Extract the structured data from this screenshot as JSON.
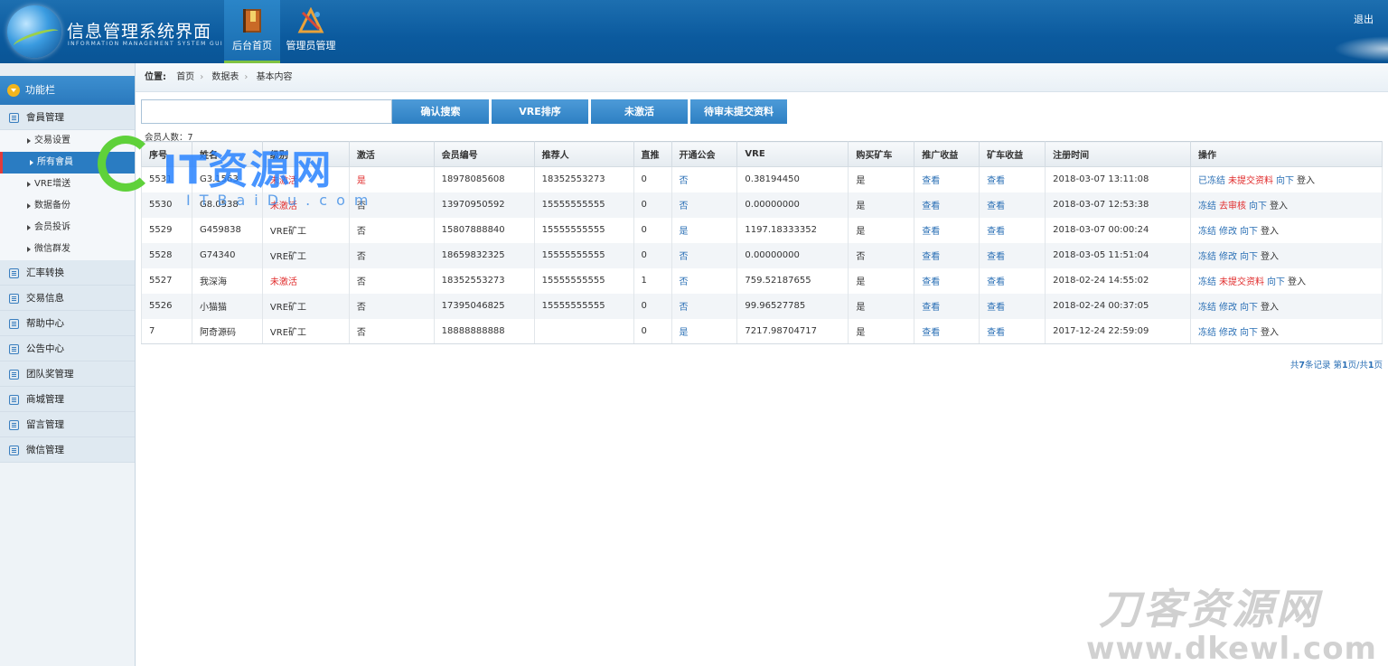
{
  "header": {
    "title": "信息管理系统界面",
    "subtitle": "INFORMATION MANAGEMENT SYSTEM GUI",
    "nav": [
      {
        "label": "后台首页",
        "icon": "book-icon"
      },
      {
        "label": "管理员管理",
        "icon": "tools-icon"
      }
    ],
    "logout": "退出"
  },
  "sidebar": {
    "title": "功能栏",
    "groups": [
      {
        "label": "會員管理",
        "icon": "list-icon"
      },
      {
        "label": "汇率转换",
        "icon": "chat-icon"
      },
      {
        "label": "交易信息",
        "icon": "list-icon"
      },
      {
        "label": "帮助中心",
        "icon": "edit-icon"
      },
      {
        "label": "公告中心",
        "icon": "edit-icon"
      },
      {
        "label": "团队奖管理",
        "icon": "calendar-icon"
      },
      {
        "label": "商城管理",
        "icon": "calendar-icon"
      },
      {
        "label": "留言管理",
        "icon": "edit-icon"
      },
      {
        "label": "微信管理",
        "icon": "chat-icon"
      }
    ],
    "subitems": [
      "交易设置",
      "所有會員",
      "VRE增送",
      "数据备份",
      "会员投诉",
      "微信群发"
    ]
  },
  "breadcrumb": {
    "label": "位置:",
    "items": [
      "首页",
      "数据表",
      "基本内容"
    ]
  },
  "search": {
    "placeholder": "",
    "buttons": [
      "确认搜索",
      "VRE排序",
      "未激活",
      "待审未提交资料"
    ]
  },
  "count_label": "会员人数：7",
  "table": {
    "headers": [
      "序号",
      "姓名",
      "级别",
      "激活",
      "会员编号",
      "推荐人",
      "直推",
      "开通公会",
      "VRE",
      "购买矿车",
      "推广收益",
      "矿车收益",
      "注册时间",
      "操作"
    ],
    "rows": [
      {
        "id": "5531",
        "name": "G3.1563",
        "level": "未激活",
        "active": "是",
        "no": "18978085608",
        "ref": "18352553273",
        "direct": "0",
        "guild": "否",
        "vre": "0.38194450",
        "buy": "是",
        "promo": "查看",
        "cart": "查看",
        "time": "2018-03-07 13:11:08",
        "ops": [
          {
            "t": "已冻结",
            "c": "link"
          },
          {
            "t": "未提交资料",
            "c": "red"
          },
          {
            "t": "向下",
            "c": "link"
          },
          {
            "t": "登入",
            "c": "plain"
          }
        ]
      },
      {
        "id": "5530",
        "name": "G8.0538",
        "level": "未激活",
        "active": "否",
        "no": "13970950592",
        "ref": "15555555555",
        "direct": "0",
        "guild": "否",
        "vre": "0.00000000",
        "buy": "是",
        "promo": "查看",
        "cart": "查看",
        "time": "2018-03-07 12:53:38",
        "ops": [
          {
            "t": "冻结",
            "c": "link"
          },
          {
            "t": "去审核",
            "c": "red"
          },
          {
            "t": "向下",
            "c": "link"
          },
          {
            "t": "登入",
            "c": "plain"
          }
        ]
      },
      {
        "id": "5529",
        "name": "G459838",
        "level": "VRE矿工",
        "active": "否",
        "no": "15807888840",
        "ref": "15555555555",
        "direct": "0",
        "guild": "是",
        "vre": "1197.18333352",
        "buy": "是",
        "promo": "查看",
        "cart": "查看",
        "time": "2018-03-07 00:00:24",
        "ops": [
          {
            "t": "冻结",
            "c": "link"
          },
          {
            "t": "修改",
            "c": "link"
          },
          {
            "t": "向下",
            "c": "link"
          },
          {
            "t": "登入",
            "c": "plain"
          }
        ]
      },
      {
        "id": "5528",
        "name": "G74340",
        "level": "VRE矿工",
        "active": "否",
        "no": "18659832325",
        "ref": "15555555555",
        "direct": "0",
        "guild": "否",
        "vre": "0.00000000",
        "buy": "否",
        "promo": "查看",
        "cart": "查看",
        "time": "2018-03-05 11:51:04",
        "ops": [
          {
            "t": "冻结",
            "c": "link"
          },
          {
            "t": "修改",
            "c": "link"
          },
          {
            "t": "向下",
            "c": "link"
          },
          {
            "t": "登入",
            "c": "plain"
          }
        ]
      },
      {
        "id": "5527",
        "name": "我深海",
        "level": "未激活",
        "active": "否",
        "no": "18352553273",
        "ref": "15555555555",
        "direct": "1",
        "guild": "否",
        "vre": "759.52187655",
        "buy": "是",
        "promo": "查看",
        "cart": "查看",
        "time": "2018-02-24 14:55:02",
        "ops": [
          {
            "t": "冻结",
            "c": "link"
          },
          {
            "t": "未提交资料",
            "c": "red"
          },
          {
            "t": "向下",
            "c": "link"
          },
          {
            "t": "登入",
            "c": "plain"
          }
        ]
      },
      {
        "id": "5526",
        "name": "小猫猫",
        "level": "VRE矿工",
        "active": "否",
        "no": "17395046825",
        "ref": "15555555555",
        "direct": "0",
        "guild": "否",
        "vre": "99.96527785",
        "buy": "是",
        "promo": "查看",
        "cart": "查看",
        "time": "2018-02-24 00:37:05",
        "ops": [
          {
            "t": "冻结",
            "c": "link"
          },
          {
            "t": "修改",
            "c": "link"
          },
          {
            "t": "向下",
            "c": "link"
          },
          {
            "t": "登入",
            "c": "plain"
          }
        ]
      },
      {
        "id": "7",
        "name": "阿奇源码",
        "level": "VRE矿工",
        "active": "否",
        "no": "18888888888",
        "ref": "",
        "direct": "0",
        "guild": "是",
        "vre": "7217.98704717",
        "buy": "是",
        "promo": "查看",
        "cart": "查看",
        "time": "2017-12-24 22:59:09",
        "ops": [
          {
            "t": "冻结",
            "c": "link"
          },
          {
            "t": "修改",
            "c": "link"
          },
          {
            "t": "向下",
            "c": "link"
          },
          {
            "t": "登入",
            "c": "plain"
          }
        ]
      }
    ]
  },
  "pager": {
    "prefix": "共",
    "total": "7",
    "mid": "条记录 第",
    "page": "1",
    "mid2": "页/共",
    "pages": "1",
    "suffix": "页"
  },
  "watermarks": {
    "it_big": "IT资源网",
    "it_small": "ITBaiDu.com",
    "dk_big": "刀客资源网",
    "dk_small": "www.dkewl.com"
  },
  "colors": {
    "header": "#0b5a9e",
    "accent": "#2d80c3",
    "link": "#2a6fb5",
    "alert": "#e02b2b",
    "active_bar": "#7fc241"
  }
}
